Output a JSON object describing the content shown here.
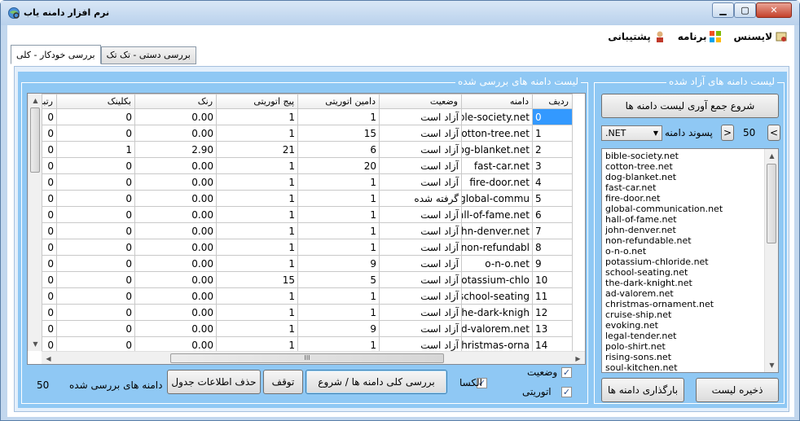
{
  "window": {
    "title": "نرم افزار دامنه یاب",
    "minimize": "▁",
    "maximize": "▢",
    "close": "✕"
  },
  "menu": [
    {
      "label": "لایسنس",
      "icon": "license-icon"
    },
    {
      "label": "برنامه",
      "icon": "windows-icon"
    },
    {
      "label": "پشتیبانی",
      "icon": "support-icon"
    }
  ],
  "tabs": {
    "auto": "بررسی خودکار - کلی",
    "manual": "بررسی دستی - تک تک"
  },
  "free_domains": {
    "title": "لیست دامنه های آزاد شده",
    "collect_button": "شروع جمع آوری لیست دامنه ها",
    "suffix_label": "پسوند دامنه",
    "suffix_value": ".NET",
    "page_prev": "<",
    "page_next": ">",
    "page_value": "50",
    "save_button": "ذخیره لیست",
    "load_button": "بارگذاری دامنه ها",
    "items": [
      "bible-society.net",
      "cotton-tree.net",
      "dog-blanket.net",
      "fast-car.net",
      "fire-door.net",
      "global-communication.net",
      "hall-of-fame.net",
      "john-denver.net",
      "non-refundable.net",
      "o-n-o.net",
      "potassium-chloride.net",
      "school-seating.net",
      "the-dark-knight.net",
      "ad-valorem.net",
      "christmas-ornament.net",
      "cruise-ship.net",
      "evoking.net",
      "legal-tender.net",
      "polo-shirt.net",
      "rising-sons.net",
      "soul-kitchen.net"
    ]
  },
  "checked_domains": {
    "title": "لیست دامنه های بررسی شده",
    "columns": {
      "row": "ردیف",
      "domain": "دامنه",
      "status": "وضعیت",
      "da": "دامین اتوریتی",
      "pa": "پیج اتوریتی",
      "rank": "رنک",
      "backlink": "بکلینک",
      "rt": "رتبه"
    },
    "rows": [
      {
        "row": "0",
        "domain": "bible-society.net",
        "status": "آزاد است",
        "da": "1",
        "pa": "1",
        "rank": "0.00",
        "backlink": "0",
        "rt": "0"
      },
      {
        "row": "1",
        "domain": "cotton-tree.net",
        "status": "آزاد است",
        "da": "15",
        "pa": "1",
        "rank": "0.00",
        "backlink": "0",
        "rt": "0"
      },
      {
        "row": "2",
        "domain": "dog-blanket.net",
        "status": "آزاد است",
        "da": "6",
        "pa": "21",
        "rank": "2.90",
        "backlink": "1",
        "rt": "0"
      },
      {
        "row": "3",
        "domain": "fast-car.net",
        "status": "آزاد است",
        "da": "20",
        "pa": "1",
        "rank": "0.00",
        "backlink": "0",
        "rt": "0"
      },
      {
        "row": "4",
        "domain": "fire-door.net",
        "status": "آزاد است",
        "da": "1",
        "pa": "1",
        "rank": "0.00",
        "backlink": "0",
        "rt": "0"
      },
      {
        "row": "5",
        "domain": "global-commu...",
        "status": "گرفته شده",
        "da": "1",
        "pa": "1",
        "rank": "0.00",
        "backlink": "0",
        "rt": "0"
      },
      {
        "row": "6",
        "domain": "hall-of-fame.net",
        "status": "آزاد است",
        "da": "1",
        "pa": "1",
        "rank": "0.00",
        "backlink": "0",
        "rt": "0"
      },
      {
        "row": "7",
        "domain": "john-denver.net",
        "status": "آزاد است",
        "da": "1",
        "pa": "1",
        "rank": "0.00",
        "backlink": "0",
        "rt": "0"
      },
      {
        "row": "8",
        "domain": "non-refundabl...",
        "status": "آزاد است",
        "da": "1",
        "pa": "1",
        "rank": "0.00",
        "backlink": "0",
        "rt": "0"
      },
      {
        "row": "9",
        "domain": "o-n-o.net",
        "status": "آزاد است",
        "da": "9",
        "pa": "1",
        "rank": "0.00",
        "backlink": "0",
        "rt": "0"
      },
      {
        "row": "10",
        "domain": "potassium-chlo...",
        "status": "آزاد است",
        "da": "5",
        "pa": "15",
        "rank": "0.00",
        "backlink": "0",
        "rt": "0"
      },
      {
        "row": "11",
        "domain": "school-seating...",
        "status": "آزاد است",
        "da": "1",
        "pa": "1",
        "rank": "0.00",
        "backlink": "0",
        "rt": "0"
      },
      {
        "row": "12",
        "domain": "the-dark-knigh...",
        "status": "آزاد است",
        "da": "1",
        "pa": "1",
        "rank": "0.00",
        "backlink": "0",
        "rt": "0"
      },
      {
        "row": "13",
        "domain": "ad-valorem.net",
        "status": "آزاد است",
        "da": "9",
        "pa": "1",
        "rank": "0.00",
        "backlink": "0",
        "rt": "0"
      },
      {
        "row": "14",
        "domain": "christmas-orna...",
        "status": "آزاد است",
        "da": "1",
        "pa": "1",
        "rank": "0.00",
        "backlink": "0",
        "rt": "0"
      }
    ],
    "scroll_grip": "III"
  },
  "controls": {
    "status_check": "وضعیت",
    "authority_check": "اتوریتی",
    "alexa_check": "الکسا",
    "start_button": "بررسی کلی دامنه ها / شروع",
    "stop_button": "توقف",
    "clear_button": "حذف اطلاعات جدول",
    "checked_count_label": "دامنه های بررسی شده",
    "checked_count_value": "50"
  }
}
